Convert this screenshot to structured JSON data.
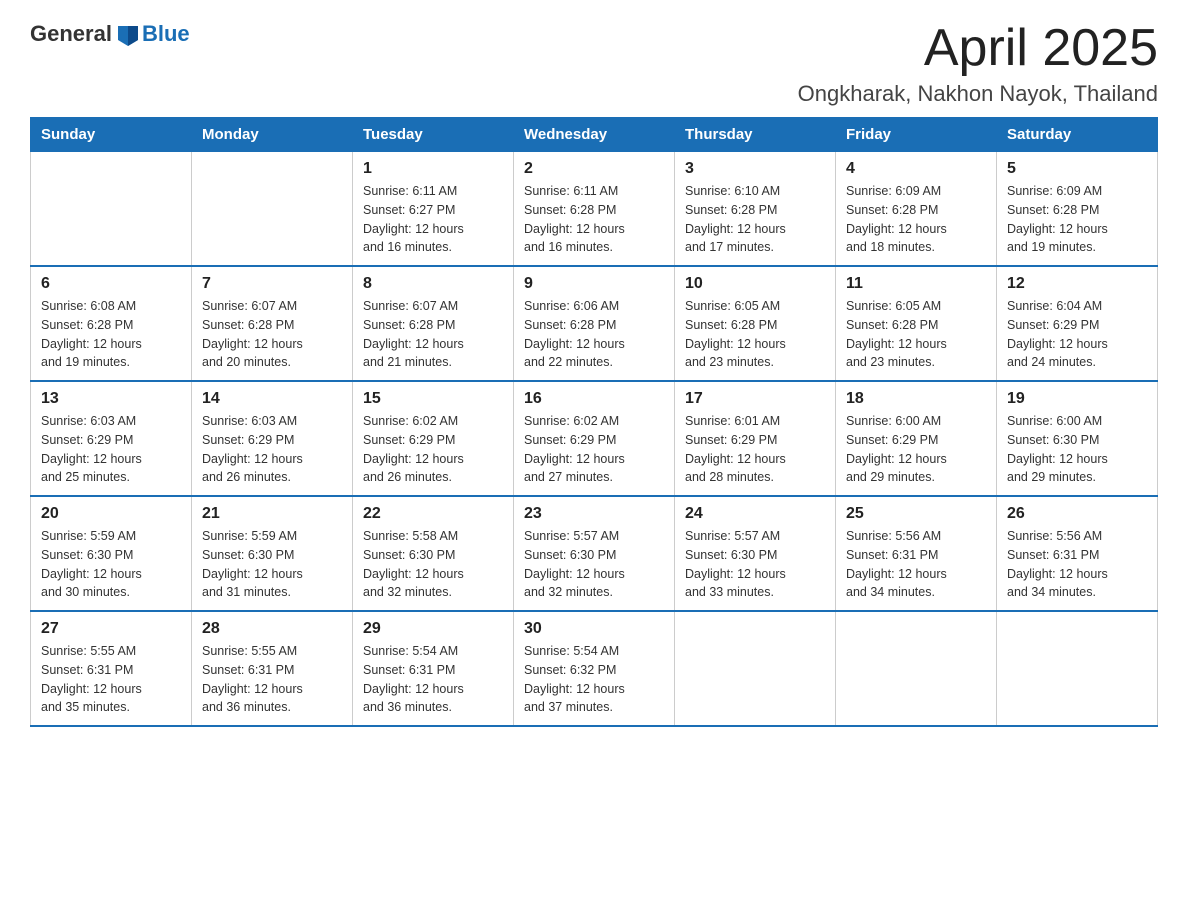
{
  "header": {
    "logo_general": "General",
    "logo_blue": "Blue",
    "title": "April 2025",
    "subtitle": "Ongkharak, Nakhon Nayok, Thailand"
  },
  "weekdays": [
    "Sunday",
    "Monday",
    "Tuesday",
    "Wednesday",
    "Thursday",
    "Friday",
    "Saturday"
  ],
  "weeks": [
    [
      {
        "day": "",
        "info": ""
      },
      {
        "day": "",
        "info": ""
      },
      {
        "day": "1",
        "info": "Sunrise: 6:11 AM\nSunset: 6:27 PM\nDaylight: 12 hours\nand 16 minutes."
      },
      {
        "day": "2",
        "info": "Sunrise: 6:11 AM\nSunset: 6:28 PM\nDaylight: 12 hours\nand 16 minutes."
      },
      {
        "day": "3",
        "info": "Sunrise: 6:10 AM\nSunset: 6:28 PM\nDaylight: 12 hours\nand 17 minutes."
      },
      {
        "day": "4",
        "info": "Sunrise: 6:09 AM\nSunset: 6:28 PM\nDaylight: 12 hours\nand 18 minutes."
      },
      {
        "day": "5",
        "info": "Sunrise: 6:09 AM\nSunset: 6:28 PM\nDaylight: 12 hours\nand 19 minutes."
      }
    ],
    [
      {
        "day": "6",
        "info": "Sunrise: 6:08 AM\nSunset: 6:28 PM\nDaylight: 12 hours\nand 19 minutes."
      },
      {
        "day": "7",
        "info": "Sunrise: 6:07 AM\nSunset: 6:28 PM\nDaylight: 12 hours\nand 20 minutes."
      },
      {
        "day": "8",
        "info": "Sunrise: 6:07 AM\nSunset: 6:28 PM\nDaylight: 12 hours\nand 21 minutes."
      },
      {
        "day": "9",
        "info": "Sunrise: 6:06 AM\nSunset: 6:28 PM\nDaylight: 12 hours\nand 22 minutes."
      },
      {
        "day": "10",
        "info": "Sunrise: 6:05 AM\nSunset: 6:28 PM\nDaylight: 12 hours\nand 23 minutes."
      },
      {
        "day": "11",
        "info": "Sunrise: 6:05 AM\nSunset: 6:28 PM\nDaylight: 12 hours\nand 23 minutes."
      },
      {
        "day": "12",
        "info": "Sunrise: 6:04 AM\nSunset: 6:29 PM\nDaylight: 12 hours\nand 24 minutes."
      }
    ],
    [
      {
        "day": "13",
        "info": "Sunrise: 6:03 AM\nSunset: 6:29 PM\nDaylight: 12 hours\nand 25 minutes."
      },
      {
        "day": "14",
        "info": "Sunrise: 6:03 AM\nSunset: 6:29 PM\nDaylight: 12 hours\nand 26 minutes."
      },
      {
        "day": "15",
        "info": "Sunrise: 6:02 AM\nSunset: 6:29 PM\nDaylight: 12 hours\nand 26 minutes."
      },
      {
        "day": "16",
        "info": "Sunrise: 6:02 AM\nSunset: 6:29 PM\nDaylight: 12 hours\nand 27 minutes."
      },
      {
        "day": "17",
        "info": "Sunrise: 6:01 AM\nSunset: 6:29 PM\nDaylight: 12 hours\nand 28 minutes."
      },
      {
        "day": "18",
        "info": "Sunrise: 6:00 AM\nSunset: 6:29 PM\nDaylight: 12 hours\nand 29 minutes."
      },
      {
        "day": "19",
        "info": "Sunrise: 6:00 AM\nSunset: 6:30 PM\nDaylight: 12 hours\nand 29 minutes."
      }
    ],
    [
      {
        "day": "20",
        "info": "Sunrise: 5:59 AM\nSunset: 6:30 PM\nDaylight: 12 hours\nand 30 minutes."
      },
      {
        "day": "21",
        "info": "Sunrise: 5:59 AM\nSunset: 6:30 PM\nDaylight: 12 hours\nand 31 minutes."
      },
      {
        "day": "22",
        "info": "Sunrise: 5:58 AM\nSunset: 6:30 PM\nDaylight: 12 hours\nand 32 minutes."
      },
      {
        "day": "23",
        "info": "Sunrise: 5:57 AM\nSunset: 6:30 PM\nDaylight: 12 hours\nand 32 minutes."
      },
      {
        "day": "24",
        "info": "Sunrise: 5:57 AM\nSunset: 6:30 PM\nDaylight: 12 hours\nand 33 minutes."
      },
      {
        "day": "25",
        "info": "Sunrise: 5:56 AM\nSunset: 6:31 PM\nDaylight: 12 hours\nand 34 minutes."
      },
      {
        "day": "26",
        "info": "Sunrise: 5:56 AM\nSunset: 6:31 PM\nDaylight: 12 hours\nand 34 minutes."
      }
    ],
    [
      {
        "day": "27",
        "info": "Sunrise: 5:55 AM\nSunset: 6:31 PM\nDaylight: 12 hours\nand 35 minutes."
      },
      {
        "day": "28",
        "info": "Sunrise: 5:55 AM\nSunset: 6:31 PM\nDaylight: 12 hours\nand 36 minutes."
      },
      {
        "day": "29",
        "info": "Sunrise: 5:54 AM\nSunset: 6:31 PM\nDaylight: 12 hours\nand 36 minutes."
      },
      {
        "day": "30",
        "info": "Sunrise: 5:54 AM\nSunset: 6:32 PM\nDaylight: 12 hours\nand 37 minutes."
      },
      {
        "day": "",
        "info": ""
      },
      {
        "day": "",
        "info": ""
      },
      {
        "day": "",
        "info": ""
      }
    ]
  ]
}
